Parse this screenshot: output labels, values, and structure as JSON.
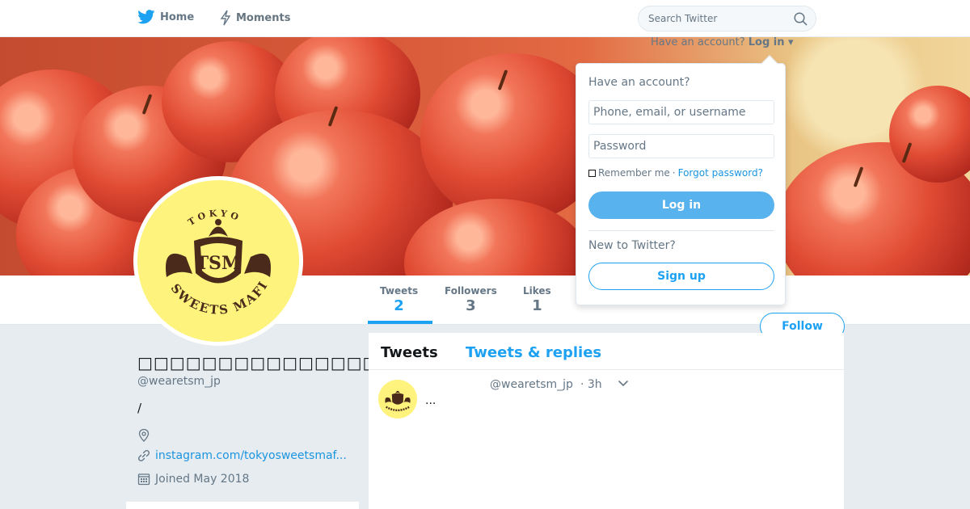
{
  "nav": {
    "home_label": "Home",
    "moments_label": "Moments",
    "search_placeholder": "Search Twitter"
  },
  "login_hint": {
    "prefix": "Have an account?",
    "link": "Log in"
  },
  "login_dropdown": {
    "heading": "Have an account?",
    "username_placeholder": "Phone, email, or username",
    "password_placeholder": "Password",
    "remember_label": "Remember me",
    "separator": "·",
    "forgot_label": "Forgot password?",
    "login_button": "Log in",
    "new_heading": "New to Twitter?",
    "signup_button": "Sign up"
  },
  "profile": {
    "name": "□□□□□□□□□□□□□□□",
    "handle": "@wearetsm_jp",
    "bio": "/",
    "location": "",
    "website": "instagram.com/tokyosweetsmaf...",
    "joined": "Joined May 2018",
    "logo_lines": [
      "TOKYO",
      "SWEETS MAFIA"
    ],
    "logo_monogram": "TSM"
  },
  "stats": [
    {
      "label": "Tweets",
      "value": "2"
    },
    {
      "label": "Followers",
      "value": "3"
    },
    {
      "label": "Likes",
      "value": "1"
    }
  ],
  "follow_button": "Follow",
  "timeline": {
    "tabs": [
      {
        "label": "Tweets"
      },
      {
        "label": "Tweets & replies"
      }
    ],
    "tweets": [
      {
        "handle": "@wearetsm_jp",
        "time": "· 3h",
        "text": "..."
      }
    ]
  },
  "colors": {
    "accent": "#1da1f2",
    "avatar_bg": "#fef37c",
    "logo_brown": "#4a2a1a"
  }
}
